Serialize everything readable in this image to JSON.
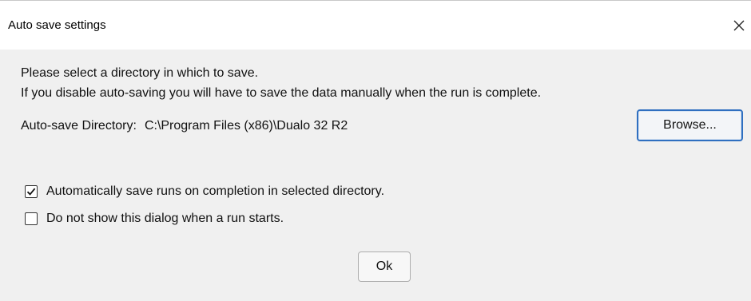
{
  "window": {
    "title": "Auto save settings"
  },
  "message": {
    "line1": "Please select a directory in which to save.",
    "line2": "If you disable auto-saving you will have to save the data manually when the run is complete."
  },
  "directory": {
    "label": "Auto-save Directory:",
    "path": "C:\\Program Files (x86)\\Dualo 32 R2",
    "browse_label": "Browse..."
  },
  "options": [
    {
      "label": "Automatically save runs on completion in selected directory.",
      "checked": true
    },
    {
      "label": "Do not show this dialog when a run starts.",
      "checked": false
    }
  ],
  "actions": {
    "ok_label": "Ok"
  },
  "colors": {
    "dialog_bg": "#f0f0f0",
    "titlebar_bg": "#ffffff",
    "focus_border": "#2f6fc0"
  },
  "icons": {
    "close": "close-icon",
    "check": "checkmark-icon"
  }
}
